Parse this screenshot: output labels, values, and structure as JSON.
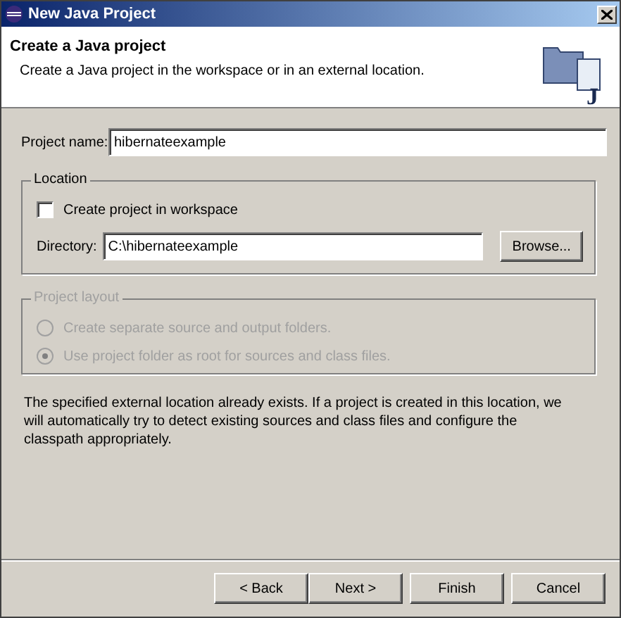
{
  "window": {
    "title": "New Java Project"
  },
  "header": {
    "icon_text": "J",
    "title": "Create a Java project",
    "description": "Create a Java project in the workspace or in an external location."
  },
  "project_name": {
    "label": "Project name:",
    "value": "hibernateexample"
  },
  "location": {
    "legend": "Location",
    "disabled": false,
    "create_in_workspace": {
      "label": "Create project in workspace",
      "checked": false
    },
    "directory": {
      "label": "Directory:",
      "value": "C:\\hibernateexample"
    },
    "browse_button": "Browse..."
  },
  "project_layout": {
    "legend": "Project layout",
    "disabled": true,
    "options": [
      {
        "label": "Create separate source and output folders.",
        "selected": false
      },
      {
        "label": "Use project folder as root for sources and class files.",
        "selected": true
      }
    ]
  },
  "message": "The specified external location already exists. If a project is created in this location, we will automatically try to detect existing sources and class files and configure the classpath appropriately.",
  "buttons": [
    {
      "label": "< Back"
    },
    {
      "label": "Next >"
    },
    {
      "label": "Finish"
    },
    {
      "label": "Cancel"
    }
  ]
}
